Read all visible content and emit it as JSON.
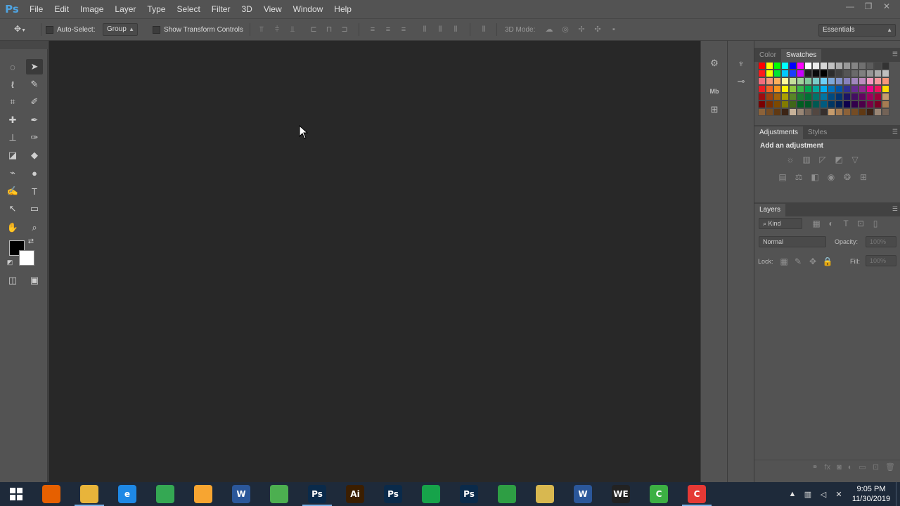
{
  "app": {
    "logo": "Ps",
    "menu": [
      "File",
      "Edit",
      "Image",
      "Layer",
      "Type",
      "Select",
      "Filter",
      "3D",
      "View",
      "Window",
      "Help"
    ],
    "window_controls": [
      "—",
      "❐",
      "✕"
    ]
  },
  "options_bar": {
    "auto_select_label": "Auto-Select:",
    "auto_select_target": "Group",
    "show_transform_label": "Show Transform Controls",
    "mode_3d_label": "3D Mode:",
    "workspace": "Essentials"
  },
  "color_panel": {
    "tabs": [
      "Color",
      "Swatches"
    ],
    "active_tab": "Swatches",
    "swatches": [
      "#ff0000",
      "#ffff00",
      "#00ff00",
      "#00ffff",
      "#0000ff",
      "#ff00ff",
      "#ffffff",
      "#ebebeb",
      "#d6d6d6",
      "#c2c2c2",
      "#adadad",
      "#999999",
      "#858585",
      "#707070",
      "#5c5c5c",
      "#474747",
      "#333333",
      "#ff1a1a",
      "#f2ff00",
      "#00e632",
      "#00c8ff",
      "#1a3cff",
      "#c800ff",
      "#1f1f1f",
      "#0a0a0a",
      "#000000",
      "#2c2c2c",
      "#404040",
      "#555555",
      "#6a6a6a",
      "#808080",
      "#959595",
      "#aaaaaa",
      "#bfbfbf",
      "#f26d7d",
      "#f7977a",
      "#fbaf5c",
      "#fff79a",
      "#c4df9b",
      "#a3d39c",
      "#82ca9c",
      "#7accc8",
      "#6dcff6",
      "#7da7d8",
      "#8393ca",
      "#8781bd",
      "#a186be",
      "#bd8cbf",
      "#f49ac1",
      "#f5989d",
      "#f7977a",
      "#ed1c24",
      "#f26522",
      "#f7941d",
      "#fff200",
      "#8dc63f",
      "#39b54a",
      "#00a651",
      "#00a99d",
      "#00aeef",
      "#0072bc",
      "#0054a6",
      "#2e3192",
      "#662d91",
      "#92278f",
      "#ec008c",
      "#ed145b",
      "#ffdd00",
      "#9e0b0f",
      "#a0410d",
      "#a36209",
      "#aba000",
      "#598527",
      "#197b30",
      "#007236",
      "#00746b",
      "#0076a3",
      "#004a80",
      "#003471",
      "#1b1464",
      "#440e62",
      "#630460",
      "#9e005d",
      "#9e0039",
      "#c69c6d",
      "#790000",
      "#7b2e00",
      "#7d4900",
      "#827b00",
      "#406618",
      "#005e20",
      "#005826",
      "#005952",
      "#005b7f",
      "#003663",
      "#002157",
      "#0d004c",
      "#32004b",
      "#4b0049",
      "#7b0046",
      "#7a0026",
      "#a67c52",
      "#8c6239",
      "#754c24",
      "#603913",
      "#3c2415",
      "#c7b299",
      "#998675",
      "#736357",
      "#534741",
      "#362f2d",
      "#c69c6d",
      "#a67c52",
      "#8c6239",
      "#754c24",
      "#603913",
      "#3c2415",
      "#998675",
      "#736357"
    ]
  },
  "adjustments_panel": {
    "tabs": [
      "Adjustments",
      "Styles"
    ],
    "active_tab": "Adjustments",
    "heading": "Add an adjustment"
  },
  "layers_panel": {
    "tab": "Layers",
    "filter_kind": "Kind",
    "blend_mode": "Normal",
    "opacity_label": "Opacity:",
    "opacity_value": "100%",
    "lock_label": "Lock:",
    "fill_label": "Fill:",
    "fill_value": "100%"
  },
  "taskbar": {
    "apps": [
      {
        "name": "firefox",
        "label": "",
        "color": "#e66000",
        "running": false
      },
      {
        "name": "file-explorer",
        "label": "",
        "color": "#e8b43a",
        "running": true
      },
      {
        "name": "internet-explorer",
        "label": "e",
        "color": "#1e88e5",
        "running": false
      },
      {
        "name": "chrome",
        "label": "",
        "color": "#34a853",
        "running": false
      },
      {
        "name": "uc-browser",
        "label": "",
        "color": "#f7a531",
        "running": false
      },
      {
        "name": "word-doc",
        "label": "W",
        "color": "#2b579a",
        "running": false
      },
      {
        "name": "sketchup",
        "label": "",
        "color": "#4caf50",
        "running": false
      },
      {
        "name": "photoshop",
        "label": "Ps",
        "color": "#0a2a4a",
        "running": true
      },
      {
        "name": "illustrator",
        "label": "Ai",
        "color": "#3b1e00",
        "running": false
      },
      {
        "name": "photoshop-2",
        "label": "Ps",
        "color": "#0a2a4a",
        "running": false
      },
      {
        "name": "store",
        "label": "",
        "color": "#16a34a",
        "running": false
      },
      {
        "name": "photoshop-3",
        "label": "Ps",
        "color": "#0a2a4a",
        "running": false
      },
      {
        "name": "green-app",
        "label": "",
        "color": "#2e9e44",
        "running": false
      },
      {
        "name": "excel-chart",
        "label": "",
        "color": "#d8b850",
        "running": false
      },
      {
        "name": "word",
        "label": "W",
        "color": "#2b579a",
        "running": false
      },
      {
        "name": "we-app",
        "label": "WE",
        "color": "#222222",
        "running": false
      },
      {
        "name": "camtasia",
        "label": "C",
        "color": "#3cb043",
        "running": false
      },
      {
        "name": "camtasia-recorder",
        "label": "C",
        "color": "#e53935",
        "running": true
      }
    ],
    "time": "9:05 PM",
    "date": "11/30/2019"
  }
}
